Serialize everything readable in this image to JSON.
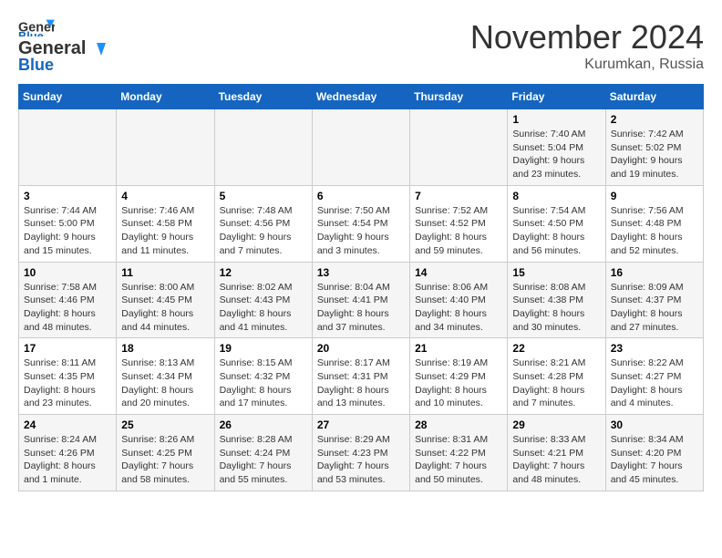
{
  "header": {
    "logo_line1": "General",
    "logo_line2": "Blue",
    "month": "November 2024",
    "location": "Kurumkan, Russia"
  },
  "weekdays": [
    "Sunday",
    "Monday",
    "Tuesday",
    "Wednesday",
    "Thursday",
    "Friday",
    "Saturday"
  ],
  "weeks": [
    [
      {
        "day": "",
        "info": ""
      },
      {
        "day": "",
        "info": ""
      },
      {
        "day": "",
        "info": ""
      },
      {
        "day": "",
        "info": ""
      },
      {
        "day": "",
        "info": ""
      },
      {
        "day": "1",
        "info": "Sunrise: 7:40 AM\nSunset: 5:04 PM\nDaylight: 9 hours\nand 23 minutes."
      },
      {
        "day": "2",
        "info": "Sunrise: 7:42 AM\nSunset: 5:02 PM\nDaylight: 9 hours\nand 19 minutes."
      }
    ],
    [
      {
        "day": "3",
        "info": "Sunrise: 7:44 AM\nSunset: 5:00 PM\nDaylight: 9 hours\nand 15 minutes."
      },
      {
        "day": "4",
        "info": "Sunrise: 7:46 AM\nSunset: 4:58 PM\nDaylight: 9 hours\nand 11 minutes."
      },
      {
        "day": "5",
        "info": "Sunrise: 7:48 AM\nSunset: 4:56 PM\nDaylight: 9 hours\nand 7 minutes."
      },
      {
        "day": "6",
        "info": "Sunrise: 7:50 AM\nSunset: 4:54 PM\nDaylight: 9 hours\nand 3 minutes."
      },
      {
        "day": "7",
        "info": "Sunrise: 7:52 AM\nSunset: 4:52 PM\nDaylight: 8 hours\nand 59 minutes."
      },
      {
        "day": "8",
        "info": "Sunrise: 7:54 AM\nSunset: 4:50 PM\nDaylight: 8 hours\nand 56 minutes."
      },
      {
        "day": "9",
        "info": "Sunrise: 7:56 AM\nSunset: 4:48 PM\nDaylight: 8 hours\nand 52 minutes."
      }
    ],
    [
      {
        "day": "10",
        "info": "Sunrise: 7:58 AM\nSunset: 4:46 PM\nDaylight: 8 hours\nand 48 minutes."
      },
      {
        "day": "11",
        "info": "Sunrise: 8:00 AM\nSunset: 4:45 PM\nDaylight: 8 hours\nand 44 minutes."
      },
      {
        "day": "12",
        "info": "Sunrise: 8:02 AM\nSunset: 4:43 PM\nDaylight: 8 hours\nand 41 minutes."
      },
      {
        "day": "13",
        "info": "Sunrise: 8:04 AM\nSunset: 4:41 PM\nDaylight: 8 hours\nand 37 minutes."
      },
      {
        "day": "14",
        "info": "Sunrise: 8:06 AM\nSunset: 4:40 PM\nDaylight: 8 hours\nand 34 minutes."
      },
      {
        "day": "15",
        "info": "Sunrise: 8:08 AM\nSunset: 4:38 PM\nDaylight: 8 hours\nand 30 minutes."
      },
      {
        "day": "16",
        "info": "Sunrise: 8:09 AM\nSunset: 4:37 PM\nDaylight: 8 hours\nand 27 minutes."
      }
    ],
    [
      {
        "day": "17",
        "info": "Sunrise: 8:11 AM\nSunset: 4:35 PM\nDaylight: 8 hours\nand 23 minutes."
      },
      {
        "day": "18",
        "info": "Sunrise: 8:13 AM\nSunset: 4:34 PM\nDaylight: 8 hours\nand 20 minutes."
      },
      {
        "day": "19",
        "info": "Sunrise: 8:15 AM\nSunset: 4:32 PM\nDaylight: 8 hours\nand 17 minutes."
      },
      {
        "day": "20",
        "info": "Sunrise: 8:17 AM\nSunset: 4:31 PM\nDaylight: 8 hours\nand 13 minutes."
      },
      {
        "day": "21",
        "info": "Sunrise: 8:19 AM\nSunset: 4:29 PM\nDaylight: 8 hours\nand 10 minutes."
      },
      {
        "day": "22",
        "info": "Sunrise: 8:21 AM\nSunset: 4:28 PM\nDaylight: 8 hours\nand 7 minutes."
      },
      {
        "day": "23",
        "info": "Sunrise: 8:22 AM\nSunset: 4:27 PM\nDaylight: 8 hours\nand 4 minutes."
      }
    ],
    [
      {
        "day": "24",
        "info": "Sunrise: 8:24 AM\nSunset: 4:26 PM\nDaylight: 8 hours\nand 1 minute."
      },
      {
        "day": "25",
        "info": "Sunrise: 8:26 AM\nSunset: 4:25 PM\nDaylight: 7 hours\nand 58 minutes."
      },
      {
        "day": "26",
        "info": "Sunrise: 8:28 AM\nSunset: 4:24 PM\nDaylight: 7 hours\nand 55 minutes."
      },
      {
        "day": "27",
        "info": "Sunrise: 8:29 AM\nSunset: 4:23 PM\nDaylight: 7 hours\nand 53 minutes."
      },
      {
        "day": "28",
        "info": "Sunrise: 8:31 AM\nSunset: 4:22 PM\nDaylight: 7 hours\nand 50 minutes."
      },
      {
        "day": "29",
        "info": "Sunrise: 8:33 AM\nSunset: 4:21 PM\nDaylight: 7 hours\nand 48 minutes."
      },
      {
        "day": "30",
        "info": "Sunrise: 8:34 AM\nSunset: 4:20 PM\nDaylight: 7 hours\nand 45 minutes."
      }
    ]
  ]
}
